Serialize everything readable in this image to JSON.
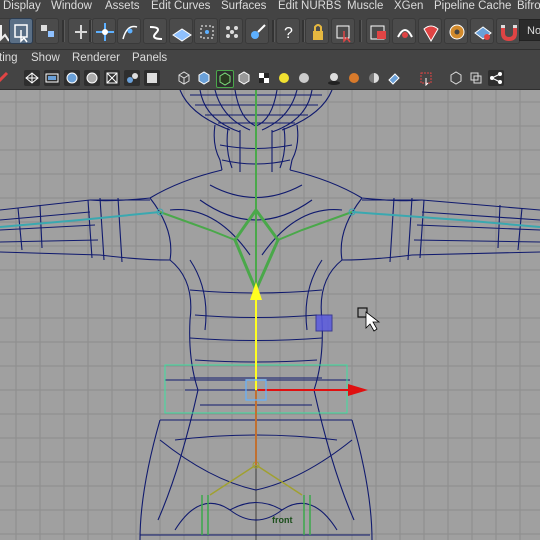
{
  "menubar": {
    "items": [
      "Display",
      "Window",
      "Assets",
      "Edit Curves",
      "Surfaces",
      "Edit NURBS",
      "Muscle",
      "XGen",
      "Pipeline Cache",
      "Bifro"
    ]
  },
  "shelf": {
    "mode_selector": "No"
  },
  "panel_menu": {
    "items": [
      "ting",
      "Show",
      "Renderer",
      "Panels"
    ]
  },
  "viewport": {
    "camera_label": "front",
    "background_color": "#a0a0a0",
    "wireframe_color": "#101a6e",
    "spine_color": "#ffff00",
    "joint_color": "#4aa84a",
    "arm_joint_color": "#3aa8b0",
    "move_x_arrow_color": "#e01010",
    "move_y_arrow_color": "#ffff20"
  }
}
